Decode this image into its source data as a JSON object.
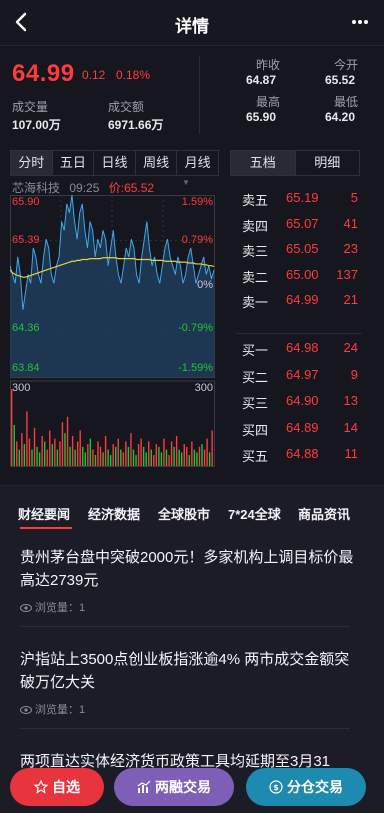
{
  "header": {
    "title": "详情"
  },
  "quote": {
    "price": "64.99",
    "change": "0.12",
    "change_pct": "0.18%",
    "volume_label": "成交量",
    "volume": "107.00万",
    "amount_label": "成交额",
    "amount": "6971.66万",
    "prev_close_label": "昨收",
    "prev_close": "64.87",
    "open_label": "今开",
    "open": "65.52",
    "high_label": "最高",
    "high": "65.90",
    "low_label": "最低",
    "low": "64.20"
  },
  "period_tabs": [
    "分时",
    "五日",
    "日线",
    "周线",
    "月线"
  ],
  "book_tabs": [
    "五档",
    "明细"
  ],
  "chart_info": {
    "name": "芯海科技",
    "time": "09:25",
    "price_text": "价:65.52"
  },
  "chart_data": {
    "type": "line",
    "price_axis": [
      "65.90",
      "65.39",
      "64.36",
      "63.84"
    ],
    "pct_axis": [
      "1.59%",
      "0.79%",
      "-0.79%",
      "-1.59%"
    ],
    "mid_pct": "0%",
    "ylim": [
      63.84,
      65.9
    ],
    "vol_label_left": "300",
    "vol_label_right": "300",
    "series": [
      {
        "values": [
          65.1,
          65.0,
          64.9,
          65.2,
          65.0,
          64.6,
          64.8,
          65.0,
          64.9,
          65.3,
          65.2,
          65.0,
          64.9,
          65.2,
          65.4,
          65.3,
          65.0,
          64.9,
          65.1,
          65.2,
          65.6,
          65.5,
          65.8,
          65.7,
          65.9,
          65.6,
          65.4,
          65.7,
          65.8,
          65.5,
          65.3,
          65.6,
          65.5,
          65.2,
          65.4,
          65.3,
          65.5,
          65.4,
          65.1,
          65.3,
          65.5,
          65.2,
          65.0,
          64.9,
          65.1,
          65.3,
          65.2,
          65.4,
          65.3,
          65.0,
          64.9,
          65.2,
          65.4,
          65.6,
          65.3,
          65.1,
          65.2,
          65.0,
          64.9,
          65.1,
          65.3,
          65.4,
          65.2,
          65.1,
          65.0,
          65.2,
          65.1,
          64.9,
          65.0,
          65.2,
          65.3,
          65.1,
          64.9,
          65.0,
          65.1,
          65.2,
          65.0,
          65.1,
          64.95,
          65.05
        ]
      },
      {
        "values": [
          65.05,
          65.02,
          65.0,
          64.99,
          64.98,
          64.97,
          64.97,
          64.98,
          64.99,
          65.0,
          65.01,
          65.02,
          65.03,
          65.04,
          65.05,
          65.06,
          65.07,
          65.08,
          65.09,
          65.1,
          65.11,
          65.12,
          65.13,
          65.14,
          65.15,
          65.15,
          65.16,
          65.16,
          65.17,
          65.17,
          65.17,
          65.18,
          65.18,
          65.18,
          65.18,
          65.18,
          65.19,
          65.19,
          65.19,
          65.19,
          65.19,
          65.19,
          65.18,
          65.18,
          65.18,
          65.18,
          65.18,
          65.18,
          65.18,
          65.17,
          65.17,
          65.17,
          65.17,
          65.17,
          65.17,
          65.16,
          65.16,
          65.16,
          65.16,
          65.16,
          65.15,
          65.15,
          65.15,
          65.15,
          65.15,
          65.14,
          65.14,
          65.14,
          65.14,
          65.13,
          65.13,
          65.13,
          65.12,
          65.12,
          65.12,
          65.11,
          65.11,
          65.1,
          65.1,
          65.09
        ]
      }
    ],
    "volume": [
      280,
      150,
      90,
      60,
      120,
      80,
      200,
      100,
      60,
      140,
      70,
      50,
      110,
      90,
      60,
      130,
      80,
      100,
      60,
      90,
      160,
      120,
      180,
      70,
      110,
      60,
      90,
      130,
      70,
      50,
      80,
      100,
      60,
      40,
      90,
      70,
      50,
      110,
      60,
      40,
      80,
      70,
      100,
      60,
      50,
      90,
      70,
      120,
      60,
      40,
      80,
      100,
      70,
      50,
      90,
      60,
      40,
      80,
      70,
      50,
      100,
      60,
      40,
      90,
      70,
      110,
      60,
      50,
      80,
      70,
      40,
      90,
      60,
      50,
      70,
      80,
      60,
      100,
      50,
      130
    ],
    "volume_colors": [
      "r",
      "g",
      "r",
      "g",
      "r",
      "g",
      "r",
      "r",
      "g",
      "r",
      "g",
      "g",
      "r",
      "g",
      "r",
      "r",
      "g",
      "r",
      "g",
      "r",
      "r",
      "g",
      "r",
      "g",
      "r",
      "g",
      "r",
      "r",
      "g",
      "g",
      "r",
      "g",
      "r",
      "g",
      "r",
      "r",
      "g",
      "r",
      "g",
      "g",
      "r",
      "g",
      "r",
      "g",
      "r",
      "r",
      "g",
      "r",
      "g",
      "g",
      "r",
      "r",
      "g",
      "g",
      "r",
      "g",
      "r",
      "r",
      "g",
      "g",
      "r",
      "g",
      "r",
      "r",
      "g",
      "r",
      "g",
      "g",
      "r",
      "r",
      "g",
      "r",
      "g",
      "g",
      "r",
      "g",
      "r",
      "r",
      "g",
      "r"
    ]
  },
  "order_book": {
    "sell": [
      {
        "name": "卖五",
        "price": "65.19",
        "vol": "5"
      },
      {
        "name": "卖四",
        "price": "65.07",
        "vol": "41"
      },
      {
        "name": "卖三",
        "price": "65.05",
        "vol": "23"
      },
      {
        "name": "卖二",
        "price": "65.00",
        "vol": "137"
      },
      {
        "name": "卖一",
        "price": "64.99",
        "vol": "21"
      }
    ],
    "buy": [
      {
        "name": "买一",
        "price": "64.98",
        "vol": "24"
      },
      {
        "name": "买二",
        "price": "64.97",
        "vol": "9"
      },
      {
        "name": "买三",
        "price": "64.90",
        "vol": "13"
      },
      {
        "name": "买四",
        "price": "64.89",
        "vol": "14"
      },
      {
        "name": "买五",
        "price": "64.88",
        "vol": "11"
      }
    ]
  },
  "news": {
    "tabs": [
      "财经要闻",
      "经济数据",
      "全球股市",
      "7*24全球",
      "商品资讯"
    ],
    "articles": [
      {
        "title": "贵州茅台盘中突破2000元！多家机构上调目标价最高达2739元",
        "views": "浏览量：1"
      },
      {
        "title": "沪指站上3500点创业板指涨逾4% 两市成交金额突破万亿大关",
        "views": "浏览量：1"
      },
      {
        "title": "两项直达实体经济货币政策工具均延期至3月31",
        "views": ""
      }
    ]
  },
  "actions": {
    "watchlist": "自选",
    "margin": "两融交易",
    "position": "分仓交易",
    "colors": {
      "watchlist": "#e8343c",
      "margin": "#7e5fb8",
      "position": "#1f8ab0"
    }
  },
  "colors": {
    "up": "#ff3b3b",
    "down": "#22c43a",
    "price_line": "#3fa8e8",
    "avg_line": "#e5d43a"
  }
}
